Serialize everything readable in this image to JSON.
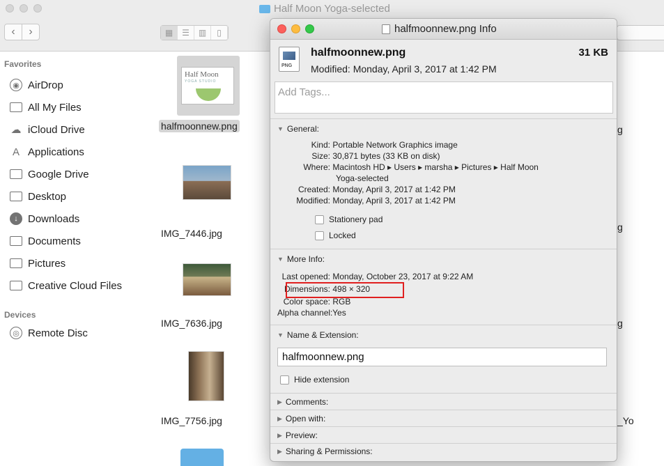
{
  "finder": {
    "window_title": "Half Moon Yoga-selected",
    "nav_back": "‹",
    "nav_forward": "›",
    "sidebar": {
      "favorites_header": "Favorites",
      "favorites": [
        {
          "label": "AirDrop",
          "icon": "airdrop-icon"
        },
        {
          "label": "All My Files",
          "icon": "all-files-icon"
        },
        {
          "label": "iCloud Drive",
          "icon": "cloud-icon"
        },
        {
          "label": "Applications",
          "icon": "applications-icon"
        },
        {
          "label": "Google Drive",
          "icon": "folder-icon"
        },
        {
          "label": "Desktop",
          "icon": "desktop-icon"
        },
        {
          "label": "Downloads",
          "icon": "download-icon"
        },
        {
          "label": "Documents",
          "icon": "documents-icon"
        },
        {
          "label": "Pictures",
          "icon": "camera-icon"
        },
        {
          "label": "Creative Cloud Files",
          "icon": "folder-icon"
        }
      ],
      "devices_header": "Devices",
      "devices": [
        {
          "label": "Remote Disc",
          "icon": "disc-icon"
        }
      ]
    },
    "files": [
      {
        "name": "halfmoonnew.png",
        "selected": true
      },
      {
        "name": "IMG_7446.jpg"
      },
      {
        "name": "IMG_7636.jpg"
      },
      {
        "name": "IMG_7756.jpg"
      }
    ],
    "right_column_fragments": [
      "g",
      "g",
      "g",
      "_Yo"
    ]
  },
  "info": {
    "title": "halfmoonnew.png Info",
    "file_name": "halfmoonnew.png",
    "file_size": "31 KB",
    "modified_header": "Modified: Monday, April 3, 2017 at 1:42 PM",
    "png_badge": "PNG",
    "tags_placeholder": "Add Tags...",
    "general": {
      "header": "General:",
      "kind_label": "Kind:",
      "kind": "Portable Network Graphics image",
      "size_label": "Size:",
      "size": "30,871 bytes (33 KB on disk)",
      "where_label": "Where:",
      "where_line1": "Macintosh HD ▸ Users ▸  marsha   ▸ Pictures ▸ Half Moon",
      "where_line2": "Yoga-selected",
      "created_label": "Created:",
      "created": "Monday, April 3, 2017 at 1:42 PM",
      "modified_label": "Modified:",
      "modified": "Monday, April 3, 2017 at 1:42 PM",
      "stationery_pad": "Stationery pad",
      "locked": "Locked"
    },
    "more_info": {
      "header": "More Info:",
      "last_opened_label": "Last opened:",
      "last_opened": "Monday, October 23, 2017 at 9:22 AM",
      "dimensions_label": "Dimensions:",
      "dimensions": "498 × 320",
      "color_space_label": "Color space:",
      "color_space": "RGB",
      "alpha_label": "Alpha channel:",
      "alpha": "Yes"
    },
    "name_extension": {
      "header": "Name & Extension:",
      "name_value": "halfmoonnew.png",
      "hide_extension": "Hide extension"
    },
    "collapsed_sections": [
      "Comments:",
      "Open with:",
      "Preview:",
      "Sharing & Permissions:"
    ]
  },
  "colors": {
    "close": "#fc605c",
    "minimize": "#fdbc40",
    "zoom": "#34c84a",
    "highlight": "#e02020"
  }
}
